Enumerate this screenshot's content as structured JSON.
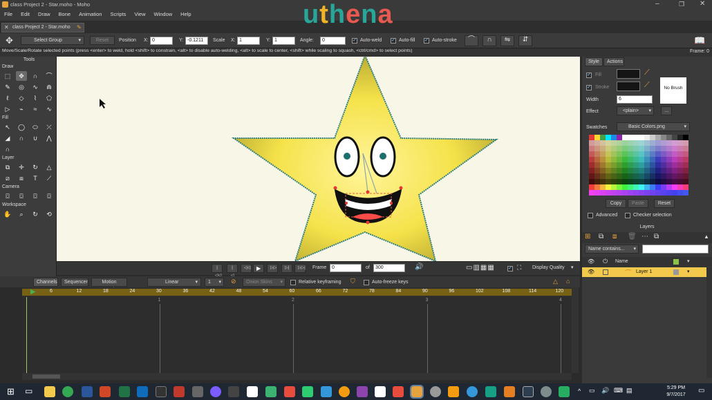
{
  "window": {
    "title": "class Project 2 - Star.moho - Moho",
    "logo": "uthena"
  },
  "menu": [
    "File",
    "Edit",
    "Draw",
    "Bone",
    "Animation",
    "Scripts",
    "View",
    "Window",
    "Help"
  ],
  "doc_tab": "class Project 2 - Star.moho",
  "tool_options": {
    "group_select": "Select Group",
    "reset": "Reset",
    "position_label": "Position",
    "x_label": "X:",
    "position_x": "0",
    "y_label": "Y:",
    "position_y": "-0.1211",
    "scale_label": "Scale",
    "scale_x_label": "X:",
    "scale_x": "1",
    "scale_y_label": "Y:",
    "scale_y": "1",
    "angle_label": "Angle:",
    "angle": "0",
    "auto_weld": "Auto-weld",
    "auto_fill": "Auto-fill",
    "auto_stroke": "Auto-stroke",
    "frame_label": "Frame: 0"
  },
  "hint": "Move/Scale/Rotate selected points (press <enter> to weld, hold <shift> to constrain, <alt> to disable auto-welding, <alt> to scale to center, <shift> while scaling to squash, <ctrl/cmd> to select points)",
  "tools": {
    "title": "Tools",
    "draw": "Draw",
    "fill": "Fill",
    "layer": "Layer",
    "camera": "Camera",
    "workspace": "Workspace"
  },
  "playback": {
    "frame_label": "Frame",
    "frame": "0",
    "of_label": "of",
    "total": "300",
    "quality": "Display Quality"
  },
  "timeline": {
    "tabs": [
      "Channels",
      "Sequencer",
      "Motion Graph"
    ],
    "interp": "Linear",
    "interp_val": "1",
    "onion": "Onion Skins",
    "relative": "Relative keyframing",
    "autofreeze": "Auto-freeze keys",
    "ruler": [
      "6",
      "12",
      "18",
      "24",
      "30",
      "36",
      "42",
      "48",
      "54",
      "60",
      "66",
      "72",
      "78",
      "84",
      "90",
      "96",
      "102",
      "108",
      "114",
      "120"
    ],
    "seconds": [
      "1",
      "2",
      "3",
      "4"
    ]
  },
  "style": {
    "tabs": [
      "Style",
      "Actions"
    ],
    "fill": "Fill",
    "stroke": "Stroke",
    "width_label": "Width",
    "width": "6",
    "effect_label": "Effect",
    "effect": "<plain>",
    "no_brush": "No Brush",
    "swatches_label": "Swatches",
    "swatches": "Basic Colors.png",
    "copy": "Copy",
    "paste": "Paste",
    "reset": "Reset",
    "advanced": "Advanced",
    "checker": "Checker selection",
    "fill_color": "#151515",
    "stroke_color": "#151515"
  },
  "layers": {
    "title": "Layers",
    "filter": "Name contains...",
    "name_col": "Name",
    "layer1": "Layer 1"
  },
  "taskbar": {
    "time": "5:29 PM",
    "date": "9/7/2017"
  }
}
